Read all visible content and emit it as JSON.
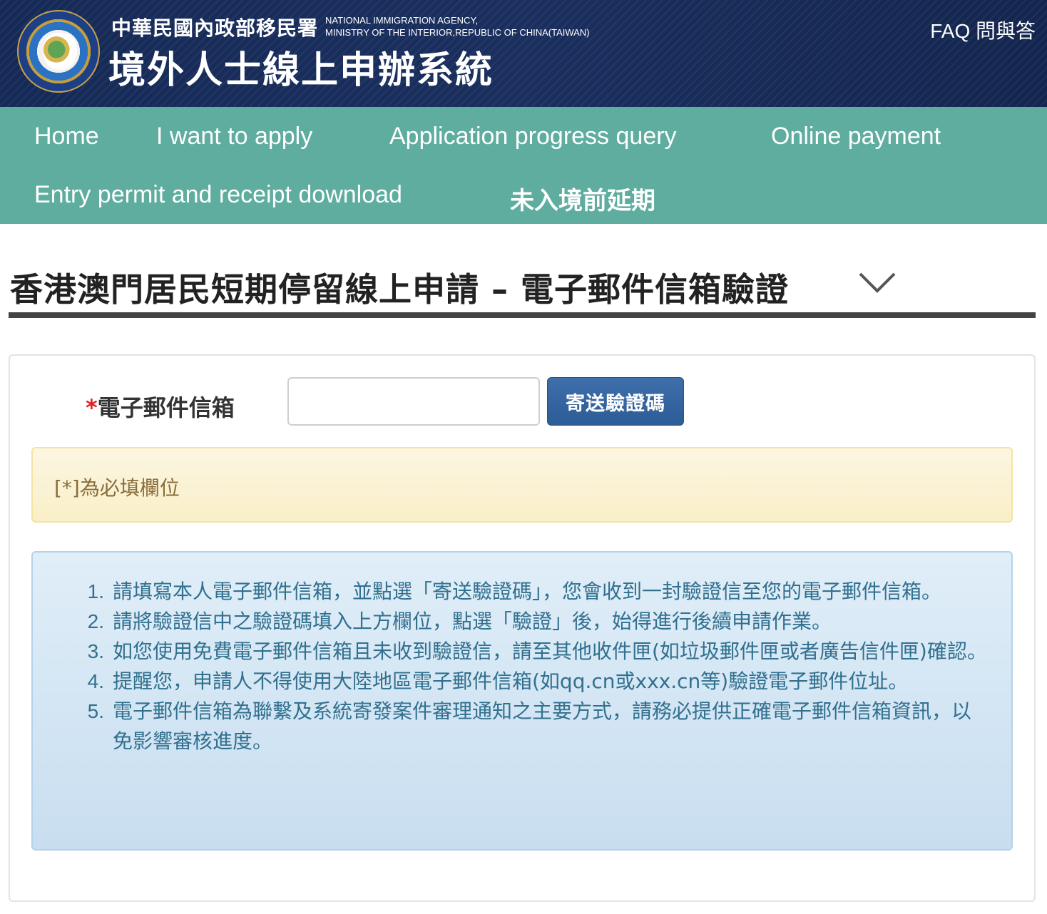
{
  "header": {
    "agency_name_zh": "中華民國內政部移民署",
    "agency_name_en_line1": "NATIONAL IMMIGRATION AGENCY,",
    "agency_name_en_line2": "MINISTRY OF THE INTERIOR,REPUBLIC OF CHINA(TAIWAN)",
    "system_title": "境外人士線上申辦系統",
    "faq_label": "FAQ 問與答",
    "logo_icon": "national-immigration-agency-seal-icon"
  },
  "nav": {
    "items": [
      {
        "label": "Home"
      },
      {
        "label": "I want to apply"
      },
      {
        "label": "Application progress query"
      },
      {
        "label": "Online payment"
      },
      {
        "label": "Entry permit and receipt download"
      },
      {
        "label": "未入境前延期"
      }
    ]
  },
  "page": {
    "title": "香港澳門居民短期停留線上申請 – 電子郵件信箱驗證",
    "title_icon": "chevron-down-icon"
  },
  "form": {
    "required_mark": "*",
    "email_label": "電子郵件信箱",
    "email_value": "",
    "send_button_label": "寄送驗證碼"
  },
  "notice": {
    "required_note": "[*]為必填欄位"
  },
  "instructions": [
    {
      "num": "1.",
      "text": "請填寫本人電子郵件信箱，並點選「寄送驗證碼」，您會收到一封驗證信至您的電子郵件信箱。"
    },
    {
      "num": "2.",
      "text": "請將驗證信中之驗證碼填入上方欄位，點選「驗證」後，始得進行後續申請作業。"
    },
    {
      "num": "3.",
      "text": "如您使用免費電子郵件信箱且未收到驗證信，請至其他收件匣(如垃圾郵件匣或者廣告信件匣)確認。"
    },
    {
      "num": "4.",
      "text": "提醒您，申請人不得使用大陸地區電子郵件信箱(如qq.cn或xxx.cn等)驗證電子郵件位址。"
    },
    {
      "num": "5.",
      "text": "電子郵件信箱為聯繫及系統寄發案件審理通知之主要方式，請務必提供正確電子郵件信箱資訊，以免影響審核進度。"
    }
  ],
  "colors": {
    "header_bg": "#172a55",
    "nav_bg": "#5ead9f",
    "button_bg": "#2d5c96",
    "warning_bg": "#fcf6e2",
    "info_bg": "#d9e9f5",
    "required_star": "#e02424"
  }
}
